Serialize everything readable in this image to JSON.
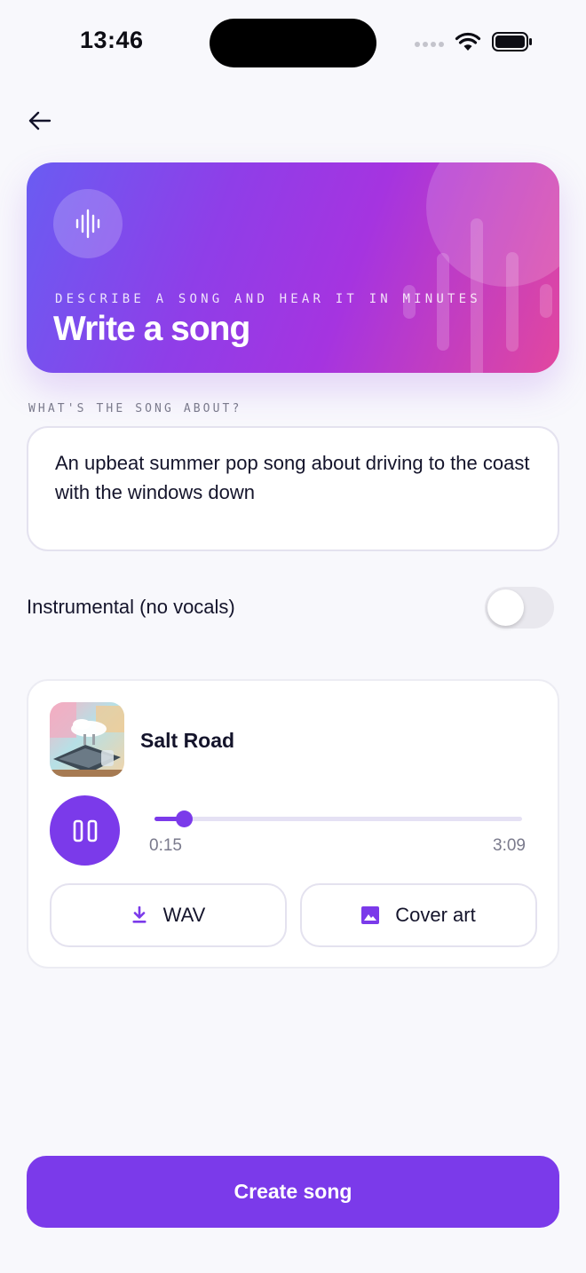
{
  "status_bar": {
    "time": "13:46"
  },
  "hero": {
    "subtitle": "DESCRIBE A SONG AND HEAR IT IN MINUTES",
    "title": "Write a song",
    "icon": "waveform-icon"
  },
  "prompt": {
    "label": "WHAT'S THE SONG ABOUT?",
    "value": "An upbeat summer pop song about driving to the coast with the windows down"
  },
  "instrumental": {
    "label": "Instrumental (no vocals)",
    "enabled": false
  },
  "player": {
    "track_title": "Salt Road",
    "current_time": "0:15",
    "total_time": "3:09",
    "progress": 0.08,
    "state": "playing",
    "actions": [
      {
        "label": "WAV",
        "icon": "download-icon"
      },
      {
        "label": "Cover art",
        "icon": "image-icon"
      }
    ]
  },
  "create_button": {
    "label": "Create song"
  },
  "colors": {
    "accent": "#7b3aea",
    "hero_gradient_start": "#6a5cf2",
    "hero_gradient_end": "#e2479f",
    "background": "#f8f8fc"
  }
}
